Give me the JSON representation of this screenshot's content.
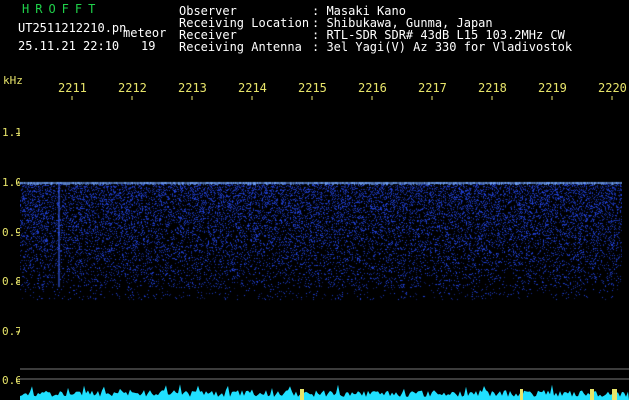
{
  "header": {
    "logo": "HROFFT",
    "filename": "UT2511212210.pn",
    "meteor_label": "meteor",
    "datetime": "25.11.21 22:10",
    "meteor_count": "19"
  },
  "info": {
    "rows": [
      {
        "label": "Observer",
        "value": ": Masaki Kano"
      },
      {
        "label": "Receiving Location",
        "value": ": Shibukawa, Gunma, Japan"
      },
      {
        "label": "Receiver",
        "value": ": RTL-SDR SDR# 43dB L15 103.2MHz CW"
      },
      {
        "label": "Receiving Antenna",
        "value": ": 3el Yagi(V) Az 330 for Vladivostok"
      }
    ]
  },
  "chart_data": {
    "type": "heatmap",
    "ylabel": "kHz",
    "y_ticks": [
      "1.1",
      "1.0",
      "0.9",
      "0.8",
      "0.7",
      "0.6"
    ],
    "x_ticks": [
      "2211",
      "2212",
      "2213",
      "2214",
      "2215",
      "2216",
      "2217",
      "2218",
      "2219",
      "2220"
    ],
    "ylim": [
      0.58,
      1.16
    ],
    "carrier_khz": 1.0,
    "signal_band_khz": [
      0.79,
      1.0
    ],
    "colors": {
      "background": "#000000",
      "signal": "#2d4dff",
      "carrier": "#6fa0ff",
      "grid": "#777777",
      "spectrum": "#20e0ff"
    }
  }
}
